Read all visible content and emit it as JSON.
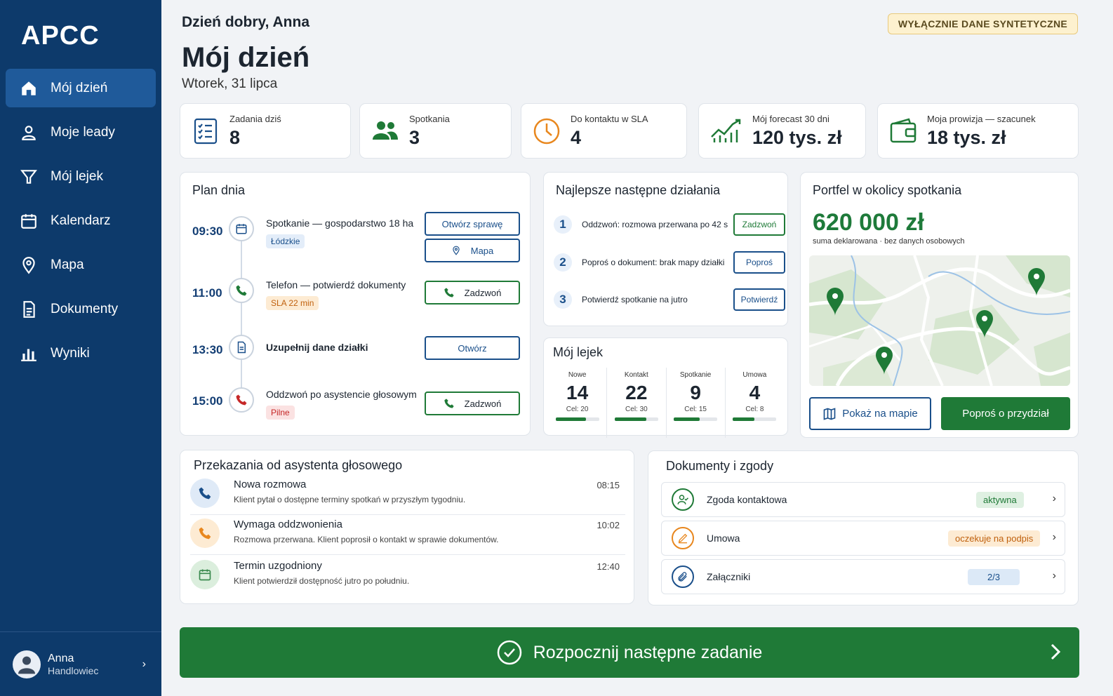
{
  "app": {
    "logo": "APCC"
  },
  "sidebar": {
    "items": [
      {
        "label": "Mój dzień",
        "icon": "home-icon",
        "active": true
      },
      {
        "label": "Moje leady",
        "icon": "person-icon"
      },
      {
        "label": "Mój lejek",
        "icon": "funnel-icon"
      },
      {
        "label": "Kalendarz",
        "icon": "calendar-icon"
      },
      {
        "label": "Mapa",
        "icon": "map-pin-icon"
      },
      {
        "label": "Dokumenty",
        "icon": "document-icon"
      },
      {
        "label": "Wyniki",
        "icon": "bar-chart-icon"
      }
    ],
    "user": {
      "name": "Anna",
      "role": "Handlowiec"
    }
  },
  "header": {
    "greeting": "Dzień dobry, Anna",
    "title": "Mój dzień",
    "date": "Wtorek, 31 lipca",
    "badge": "WYŁĄCZNIE DANE SYNTETYCZNE"
  },
  "kpis": [
    {
      "label": "Zadania dziś",
      "value": "8",
      "icon": "checklist-icon"
    },
    {
      "label": "Spotkania",
      "value": "3",
      "icon": "people-icon"
    },
    {
      "label": "Do kontaktu w SLA",
      "value": "4",
      "icon": "clock-icon"
    },
    {
      "label": "Mój forecast 30 dni",
      "value": "120 tys. zł",
      "icon": "trend-icon"
    },
    {
      "label": "Moja prowizja — szacunek",
      "value": "18 tys. zł",
      "icon": "wallet-icon"
    }
  ],
  "plan": {
    "title": "Plan dnia",
    "items": [
      {
        "time": "09:30",
        "text": "Spotkanie — gospodarstwo 18 ha",
        "tag": "Łódzkie",
        "buttons": [
          "Otwórz sprawę",
          "Mapa"
        ]
      },
      {
        "time": "11:00",
        "text": "Telefon — potwierdź dokumenty",
        "tag": "SLA 22 min",
        "buttons": [
          "Zadzwoń"
        ]
      },
      {
        "time": "13:30",
        "text": "Uzupełnij dane działki",
        "tag": "",
        "buttons": [
          "Otwórz"
        ]
      },
      {
        "time": "15:00",
        "text": "Oddzwoń po asystencie głosowym",
        "tag": "Pilne",
        "buttons": [
          "Zadzwoń"
        ]
      }
    ]
  },
  "actions": {
    "title": "Najlepsze następne działania",
    "items": [
      {
        "num": "1",
        "text": "Oddzwoń: rozmowa przerwana po 42 s",
        "button": "Zadzwoń"
      },
      {
        "num": "2",
        "text": "Poproś o dokument: brak mapy działki",
        "button": "Poproś"
      },
      {
        "num": "3",
        "text": "Potwierdź spotkanie na jutro",
        "button": "Potwierdź"
      }
    ]
  },
  "funnel": {
    "title": "Mój lejek",
    "stages": [
      {
        "label": "Nowe",
        "value": "14",
        "goal": "Cel: 20",
        "progress": 0.7
      },
      {
        "label": "Kontakt",
        "value": "22",
        "goal": "Cel: 30",
        "progress": 0.73
      },
      {
        "label": "Spotkanie",
        "value": "9",
        "goal": "Cel: 15",
        "progress": 0.6
      },
      {
        "label": "Umowa",
        "value": "4",
        "goal": "Cel: 8",
        "progress": 0.5
      }
    ]
  },
  "portfolio": {
    "title": "Portfel w okolicy spotkania",
    "amount": "620 000 zł",
    "subtitle": "suma deklarowana · bez danych osobowych",
    "btn_map": "Pokaż na mapie",
    "btn_assign": "Poproś o przydział"
  },
  "handoffs": {
    "title": "Przekazania od asystenta głosowego",
    "items": [
      {
        "title": "Nowa rozmowa",
        "desc": "Klient pytał o dostępne terminy spotkań w przyszłym tygodniu.",
        "time": "08:15",
        "icon": "phone-icon"
      },
      {
        "title": "Wymaga oddzwonienia",
        "desc": "Rozmowa przerwana. Klient poprosił o kontakt w sprawie dokumentów.",
        "time": "10:02",
        "icon": "phone-icon"
      },
      {
        "title": "Termin uzgodniony",
        "desc": "Klient potwierdził dostępność jutro po południu.",
        "time": "12:40",
        "icon": "calendar-icon"
      }
    ]
  },
  "documents": {
    "title": "Dokumenty i zgody",
    "items": [
      {
        "label": "Zgoda kontaktowa",
        "badge": "aktywna",
        "icon": "user-check-icon"
      },
      {
        "label": "Umowa",
        "badge": "oczekuje na podpis",
        "icon": "pen-icon"
      },
      {
        "label": "Załączniki",
        "badge": "2/3",
        "icon": "paperclip-icon"
      }
    ]
  },
  "cta": {
    "label": "Rozpocznij następne zadanie"
  },
  "colors": {
    "sidebar": "#0d3a6b",
    "primary": "#1a4f8a",
    "success": "#1f7a37",
    "warning": "#e8871e",
    "danger": "#c62828"
  }
}
